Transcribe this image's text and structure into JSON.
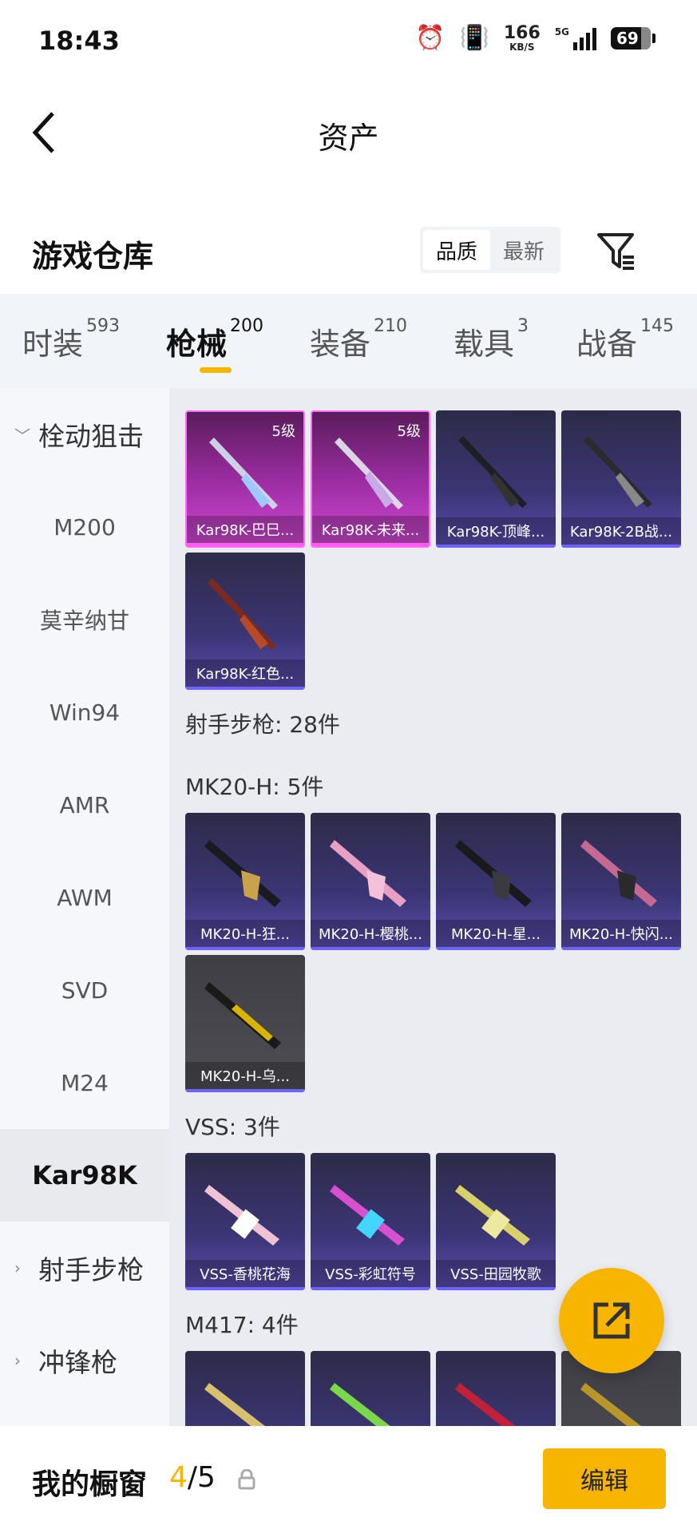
{
  "status_bar": {
    "time": "18:43",
    "speed_value": "166",
    "speed_unit": "KB/S",
    "network": "5G",
    "battery": "69"
  },
  "nav": {
    "title": "资产"
  },
  "warehouse": {
    "title": "游戏仓库",
    "sort": {
      "quality": "品质",
      "latest": "最新",
      "selected": "品质"
    }
  },
  "tabs": [
    {
      "label": "时装",
      "count": "593"
    },
    {
      "label": "枪械",
      "count": "200",
      "active": true
    },
    {
      "label": "装备",
      "count": "210"
    },
    {
      "label": "载具",
      "count": "3"
    },
    {
      "label": "战备",
      "count": "145"
    }
  ],
  "sidebar": [
    {
      "label": "栓动狙击",
      "type": "category",
      "expanded": true
    },
    {
      "label": "M200"
    },
    {
      "label": "莫辛纳甘"
    },
    {
      "label": "Win94"
    },
    {
      "label": "AMR"
    },
    {
      "label": "AWM"
    },
    {
      "label": "SVD"
    },
    {
      "label": "M24"
    },
    {
      "label": "Kar98K",
      "active": true
    },
    {
      "label": "射手步枪",
      "type": "category",
      "expanded": false
    },
    {
      "label": "冲锋枪",
      "type": "category",
      "expanded": false
    }
  ],
  "content": {
    "kar98k_items": [
      {
        "name": "Kar98K-巴巳...",
        "level": "5级",
        "rarity": "pink"
      },
      {
        "name": "Kar98K-未来...",
        "level": "5级",
        "rarity": "pink"
      },
      {
        "name": "Kar98K-顶峰...",
        "rarity": "purple"
      },
      {
        "name": "Kar98K-2B战...",
        "rarity": "purple"
      },
      {
        "name": "Kar98K-红色...",
        "rarity": "purple"
      }
    ],
    "category_header": "射手步枪: 28件",
    "groups": [
      {
        "header": "MK20-H: 5件",
        "items": [
          {
            "name": "MK20-H-狂...",
            "rarity": "purple"
          },
          {
            "name": "MK20-H-樱桃...",
            "rarity": "purple"
          },
          {
            "name": "MK20-H-星...",
            "rarity": "purple"
          },
          {
            "name": "MK20-H-快闪...",
            "rarity": "purple"
          },
          {
            "name": "MK20-H-乌...",
            "rarity": "gray"
          }
        ]
      },
      {
        "header": "VSS: 3件",
        "items": [
          {
            "name": "VSS-香桃花海",
            "rarity": "purple"
          },
          {
            "name": "VSS-彩虹符号",
            "rarity": "purple"
          },
          {
            "name": "VSS-田园牧歌",
            "rarity": "purple"
          }
        ]
      },
      {
        "header": "M417: 4件",
        "items": [
          {
            "name": "",
            "rarity": "purple"
          },
          {
            "name": "",
            "rarity": "purple"
          },
          {
            "name": "",
            "rarity": "purple"
          },
          {
            "name": "",
            "rarity": "gray"
          }
        ]
      }
    ]
  },
  "bottom_bar": {
    "label": "我的橱窗",
    "current": "4",
    "separator": "/",
    "total": "5",
    "edit_button": "编辑"
  },
  "colors": {
    "accent": "#f7b500",
    "purple_bar": "#6d63ff",
    "pink_border": "#ff6cf3"
  }
}
